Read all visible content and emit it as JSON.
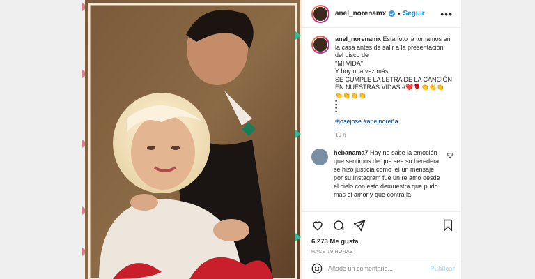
{
  "post": {
    "username": "anel_norenamx",
    "follow_label": "Seguir",
    "separator": "•",
    "more_label": "•••"
  },
  "caption": {
    "author": "anel_norenamx",
    "lines": [
      "Esta foto la tomamos en la casa antes de salir a la presentación del disco de",
      "\"MI VIDA\"",
      "Y hoy una vez más:",
      "SE CUMPLE LA LETRA DE LA CANCIÓN EN NUESTRAS VIDAS #❤️🌹👏👏👏",
      "👏👏👏👏",
      "•",
      "•",
      "•",
      "•"
    ],
    "hashtags": "#josejose #anelnoreña",
    "time": "19 h"
  },
  "comment": {
    "author": "hebanama7",
    "text": "Hay no sabe la emoción que sentimos de que sea su heredera se hizo justicia como leí un mensaje por su Instagram fue un re amo desde el cielo con esto demuestra que pudo más el amor y que contra la"
  },
  "footer": {
    "likes": "6.273 Me gusta",
    "ago": "HACE 19 HORAS",
    "add_comment_placeholder": "Añade un comentario...",
    "publish_label": "Publicar"
  },
  "colors": {
    "link_blue": "#0095f6",
    "accent_green": "#2bbf97",
    "accent_pink": "#e77b8e"
  },
  "icons": [
    "heart-icon",
    "comment-icon",
    "share-icon",
    "bookmark-icon",
    "emoji-icon",
    "verified-icon"
  ]
}
